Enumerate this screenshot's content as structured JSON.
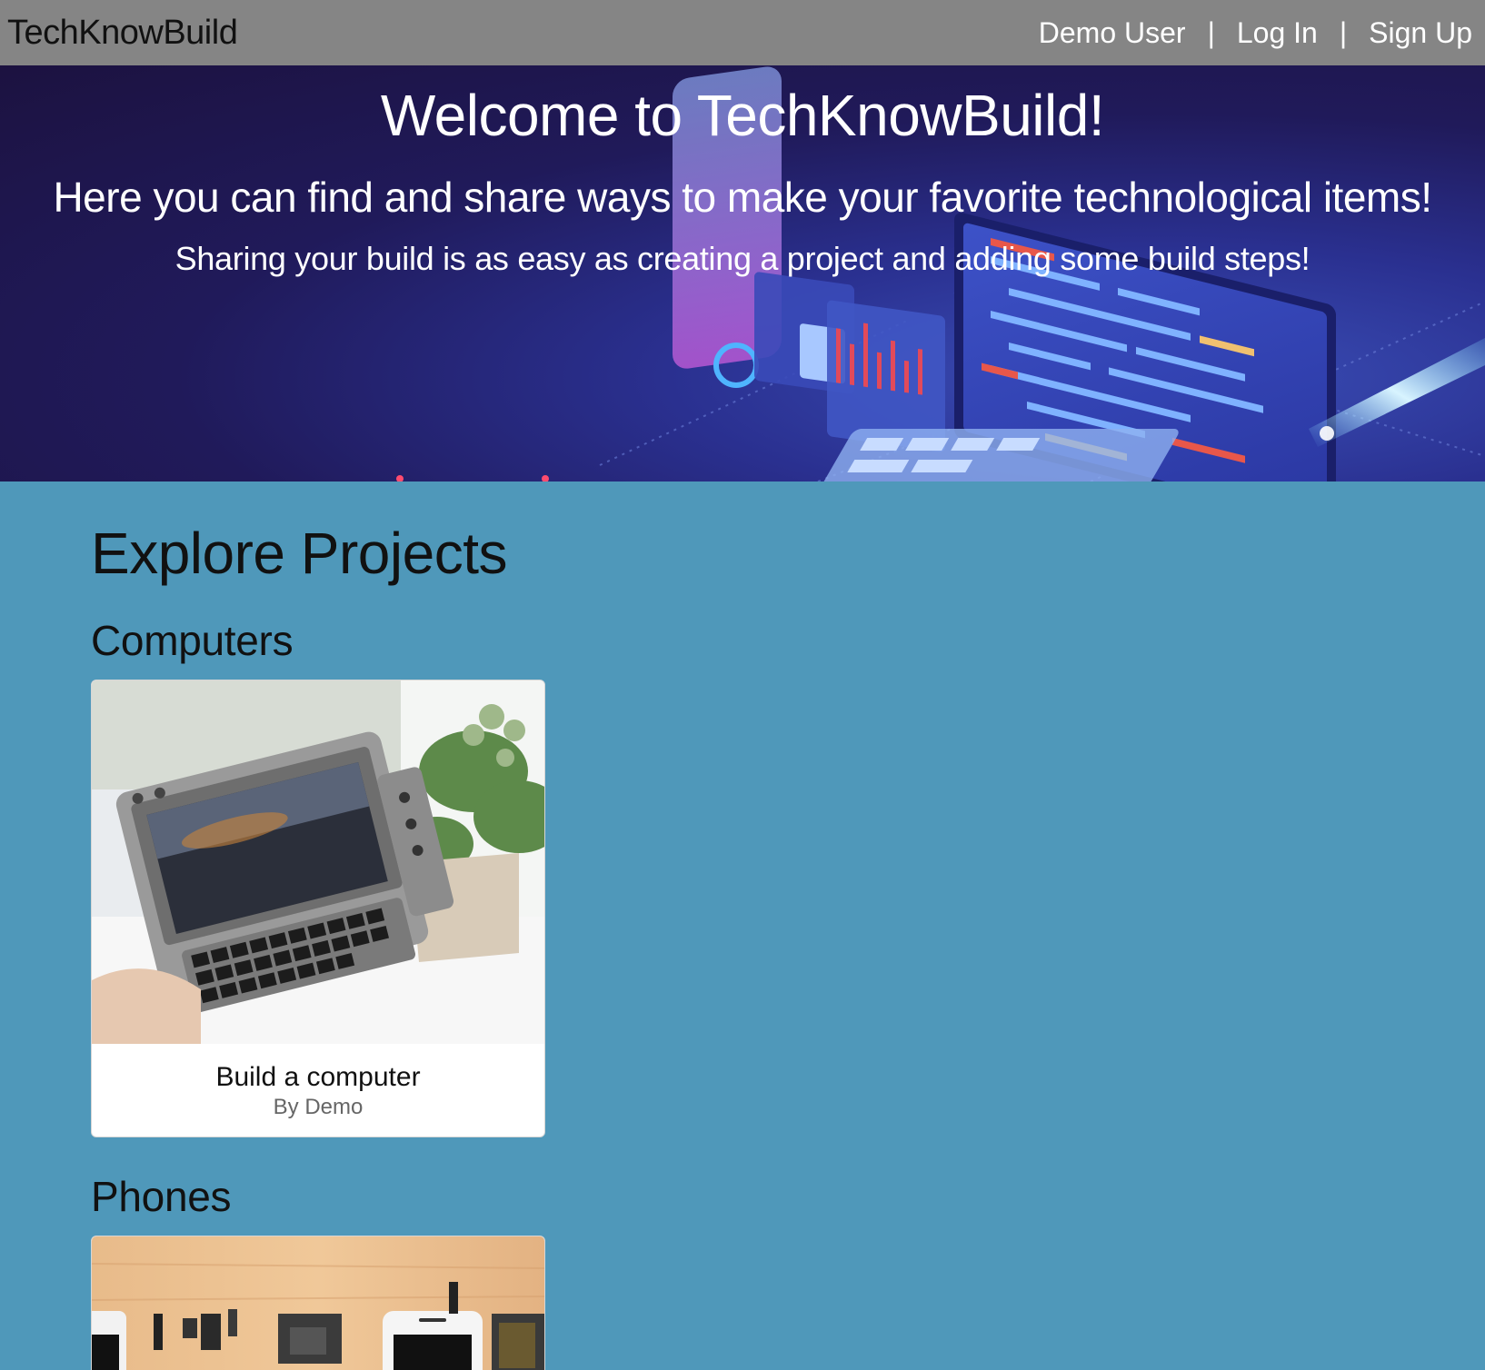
{
  "nav": {
    "brand": "TechKnowBuild",
    "links": [
      "Demo User",
      "Log In",
      "Sign Up"
    ],
    "separator": "|"
  },
  "hero": {
    "title": "Welcome to TechKnowBuild!",
    "subtitle": "Here you can find and share ways to make your favorite technological items!",
    "subtitle2": "Sharing your build is as easy as creating a project and adding some build steps!"
  },
  "main": {
    "heading": "Explore Projects",
    "categories": [
      {
        "name": "Computers",
        "projects": [
          {
            "title": "Build a computer",
            "author": "By Demo"
          }
        ]
      },
      {
        "name": "Phones",
        "projects": []
      }
    ]
  },
  "colors": {
    "nav_bg": "#858585",
    "page_bg": "#4f98ba",
    "hero_bg": "#1c1240"
  }
}
